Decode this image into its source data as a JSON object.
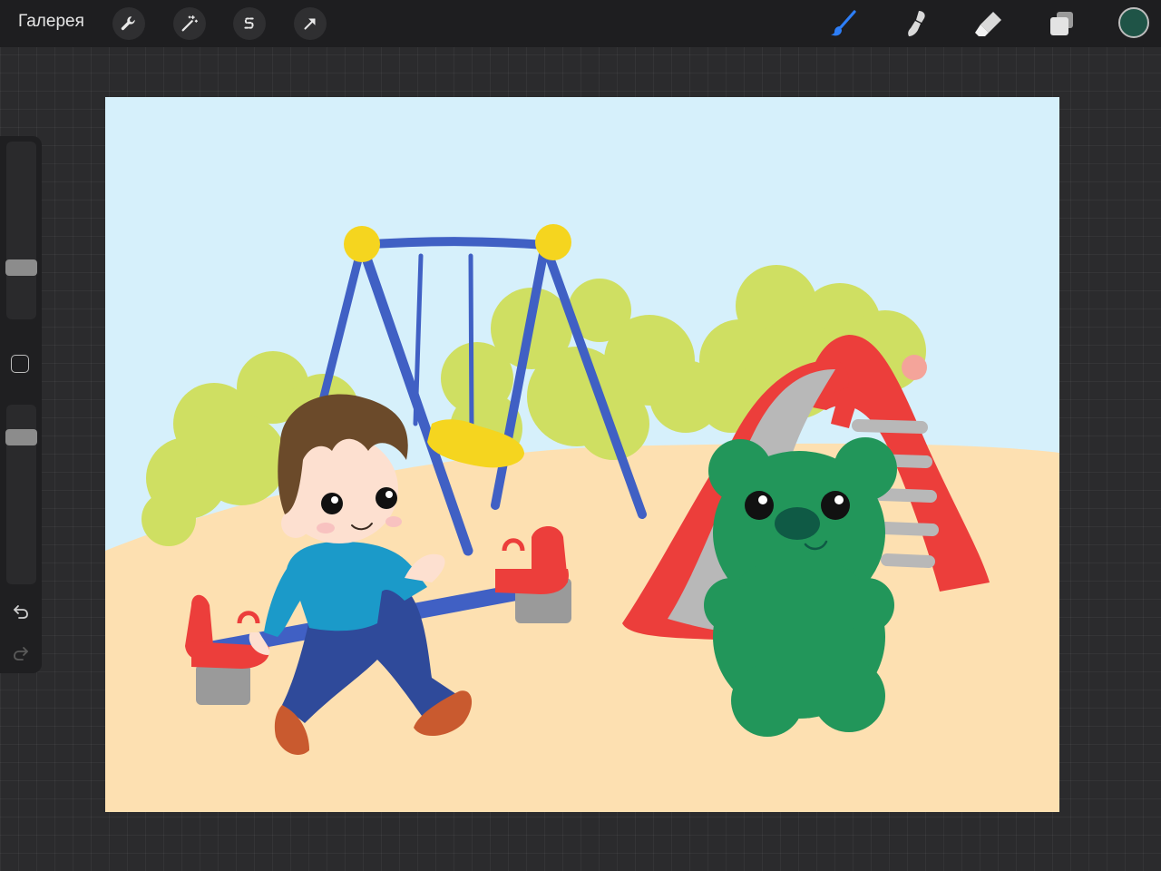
{
  "toolbar": {
    "gallery_label": "Галерея",
    "left_tools": [
      "wrench-icon",
      "magic-wand-icon",
      "selection-s-icon",
      "transform-arrow-icon"
    ],
    "right_tools": [
      "brush-icon",
      "smudge-icon",
      "eraser-icon",
      "layers-icon"
    ],
    "active_tool": "brush",
    "accent_color": "#2d7ef7",
    "current_color": "#1f5447"
  },
  "sidebar": {
    "brush_size_level": 0.27,
    "opacity_level": 0.85,
    "buttons": [
      "modify-square-icon",
      "undo-icon",
      "redo-icon"
    ]
  },
  "canvas": {
    "colors": {
      "sky": "#d6f0fb",
      "ground": "#fde0b1",
      "bush": "#cfdf62",
      "swing_frame": "#4060c4",
      "swing_caps": "#f5d51f",
      "slide_red": "#ec3e3b",
      "slide_grey": "#b8b8b8",
      "bear": "#22965a",
      "shirt": "#1b9ac9",
      "pants": "#2f4a9a",
      "hair": "#6b4a2a",
      "skin": "#fde0d0"
    }
  }
}
